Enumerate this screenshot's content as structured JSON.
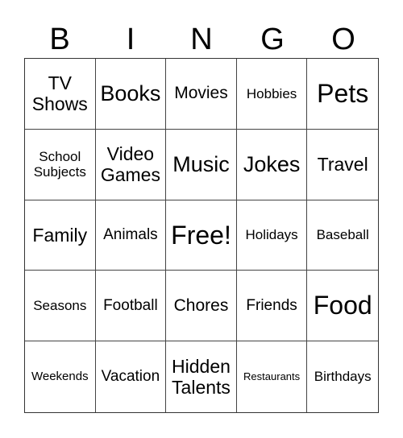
{
  "header": {
    "letters": [
      "B",
      "I",
      "N",
      "G",
      "O"
    ]
  },
  "card": {
    "rows": [
      [
        "TV Shows",
        "Books",
        "Movies",
        "Hobbies",
        "Pets"
      ],
      [
        "School Subjects",
        "Video Games",
        "Music",
        "Jokes",
        "Travel"
      ],
      [
        "Family",
        "Animals",
        "Free!",
        "Holidays",
        "Baseball"
      ],
      [
        "Seasons",
        "Football",
        "Chores",
        "Friends",
        "Food"
      ],
      [
        "Weekends",
        "Vacation",
        "Hidden Talents",
        "Restaurants",
        "Birthdays"
      ]
    ]
  }
}
